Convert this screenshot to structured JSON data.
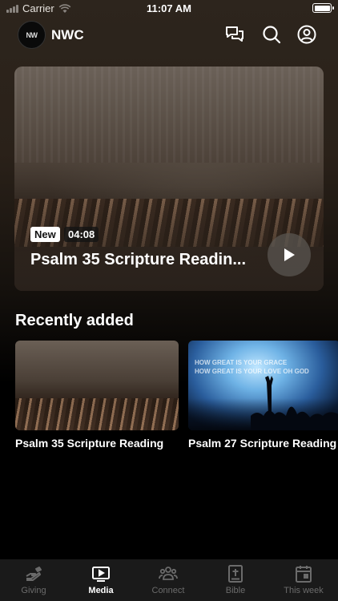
{
  "status": {
    "carrier": "Carrier",
    "time": "11:07 AM"
  },
  "header": {
    "logo_text": "NW",
    "org_name": "NWC"
  },
  "hero": {
    "badge_new": "New",
    "duration": "04:08",
    "title": "Psalm 35 Scripture Readin..."
  },
  "recent": {
    "title": "Recently added",
    "items": [
      {
        "title": "Psalm 35 Scripture Reading"
      },
      {
        "title": "Psalm 27 Scripture Reading",
        "lyrics": [
          "HOW GREAT IS YOUR GRACE",
          "HOW GREAT IS YOUR LOVE OH GOD"
        ]
      }
    ]
  },
  "tabs": [
    {
      "label": "Giving",
      "icon": "giving-icon"
    },
    {
      "label": "Media",
      "icon": "media-icon",
      "active": true
    },
    {
      "label": "Connect",
      "icon": "connect-icon"
    },
    {
      "label": "Bible",
      "icon": "bible-icon"
    },
    {
      "label": "This week",
      "icon": "calendar-icon"
    }
  ]
}
